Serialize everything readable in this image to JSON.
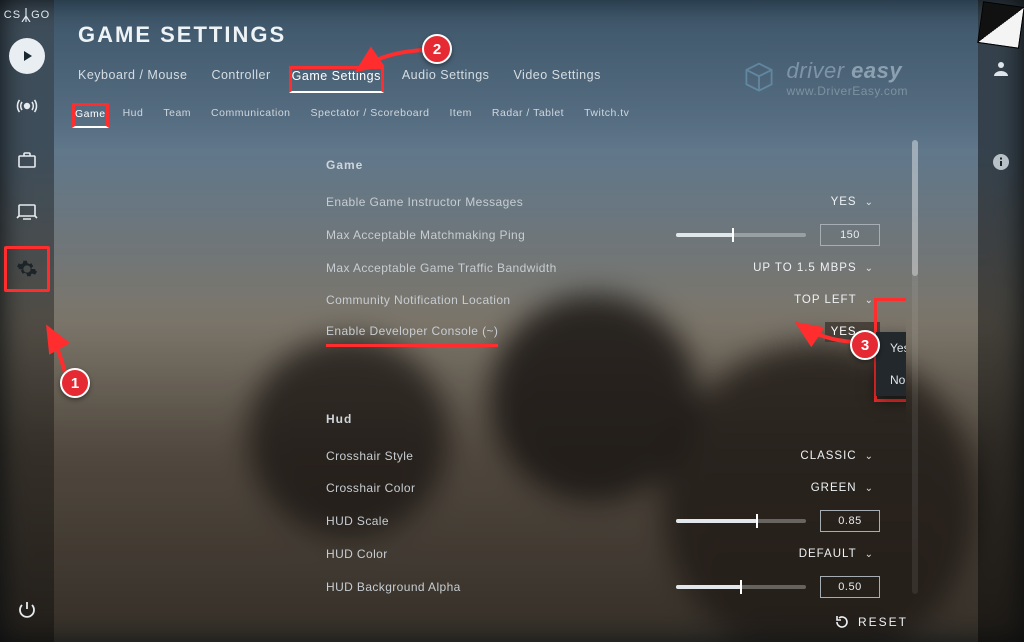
{
  "logo": "CS:GO",
  "page_title": "GAME SETTINGS",
  "tabs_primary": [
    {
      "label": "Keyboard / Mouse"
    },
    {
      "label": "Controller"
    },
    {
      "label": "Game Settings",
      "active": true
    },
    {
      "label": "Audio Settings"
    },
    {
      "label": "Video Settings"
    }
  ],
  "tabs_secondary": [
    {
      "label": "Game",
      "active": true
    },
    {
      "label": "Hud"
    },
    {
      "label": "Team"
    },
    {
      "label": "Communication"
    },
    {
      "label": "Spectator / Scoreboard"
    },
    {
      "label": "Item"
    },
    {
      "label": "Radar / Tablet"
    },
    {
      "label": "Twitch.tv"
    }
  ],
  "sections": {
    "game": {
      "title": "Game",
      "rows": {
        "instructor": {
          "label": "Enable Game Instructor Messages",
          "value": "YES"
        },
        "ping": {
          "label": "Max Acceptable Matchmaking Ping",
          "value": "150",
          "slider_pct": 44
        },
        "bandwidth": {
          "label": "Max Acceptable Game Traffic Bandwidth",
          "value": "UP TO 1.5 MBPS"
        },
        "notify": {
          "label": "Community Notification Location",
          "value": "TOP LEFT"
        },
        "devcon": {
          "label": "Enable Developer Console (~)",
          "value": "YES",
          "options": [
            "Yes",
            "No"
          ]
        }
      }
    },
    "hud": {
      "title": "Hud",
      "rows": {
        "xstyle": {
          "label": "Crosshair Style",
          "value": "CLASSIC"
        },
        "xcolor": {
          "label": "Crosshair Color",
          "value": "GREEN"
        },
        "hudscale": {
          "label": "HUD Scale",
          "value": "0.85",
          "slider_pct": 62
        },
        "hudcolor": {
          "label": "HUD Color",
          "value": "DEFAULT"
        },
        "hudbg": {
          "label": "HUD Background Alpha",
          "value": "0.50",
          "slider_pct": 50
        }
      }
    }
  },
  "reset_label": "RESET",
  "watermark": {
    "brand_a": "driver",
    "brand_b": "easy",
    "url": "www.DriverEasy.com"
  },
  "annotations": {
    "a1": "1",
    "a2": "2",
    "a3": "3"
  }
}
